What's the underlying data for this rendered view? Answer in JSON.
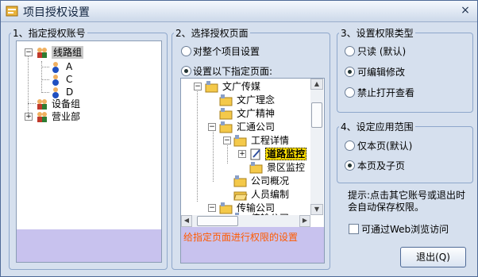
{
  "window": {
    "title": "项目授权设置",
    "close": "×"
  },
  "accounts": {
    "legend": "1、指定授权账号",
    "items": [
      {
        "label": "线路组",
        "selected": true
      },
      {
        "label": "A"
      },
      {
        "label": "C"
      },
      {
        "label": "D"
      },
      {
        "label": "设备组"
      },
      {
        "label": "营业部"
      }
    ]
  },
  "pages": {
    "legend": "2、选择授权页面",
    "option_whole": "对整个项目设置",
    "option_specific": "设置以下指定页面:",
    "tree": [
      "文广传媒",
      "文广理念",
      "文广精神",
      "汇通公司",
      "工程详情",
      "道路监控",
      "景区监控",
      "公司概况",
      "人员编制",
      "传输公司",
      "传输公司"
    ],
    "hint": "给指定页面进行权限的设置"
  },
  "permission": {
    "legend": "3、设置权限类型",
    "options": [
      "只读  (默认)",
      "可编辑修改",
      "禁止打开查看"
    ]
  },
  "scope": {
    "legend": "4、设定应用范围",
    "options": [
      "仅本页(默认)",
      "本页及子页"
    ]
  },
  "tip": "提示:点击其它账号或退出时会自动保存权限。",
  "web_access": "可通过Web浏览访问",
  "exit_button": "退出(Q)",
  "colors": {
    "accent": "#4f6a97",
    "hint_text": "#ff5a00",
    "info_bg": "#c8c2ee"
  }
}
